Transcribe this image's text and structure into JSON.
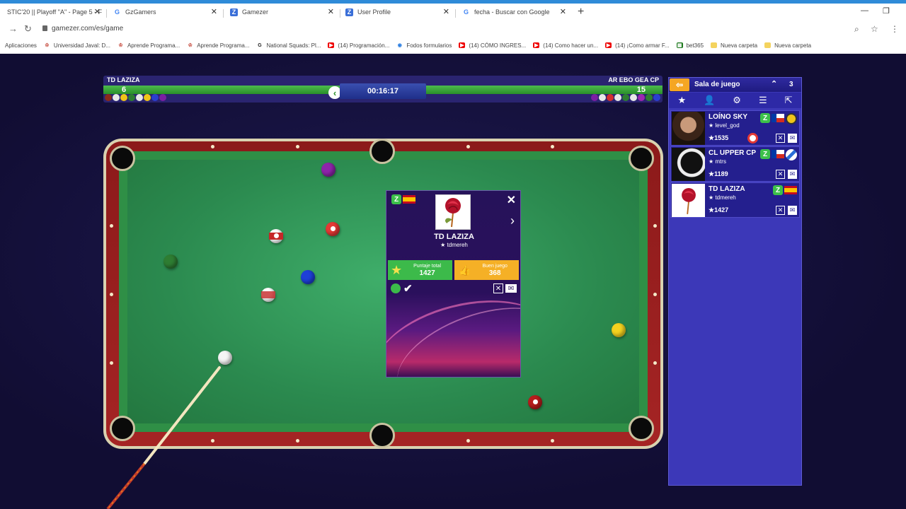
{
  "browser": {
    "tabs": [
      {
        "title": "STIC'20 || Playoff \"A\" - Page 5 - F",
        "favicon": "page-loading-icon"
      },
      {
        "title": "GzGamers",
        "favicon": "google-icon"
      },
      {
        "title": "Gamezer",
        "favicon": "gamezer-icon"
      },
      {
        "title": "User Profile",
        "favicon": "gamezer-icon"
      },
      {
        "title": "fecha - Buscar con Google",
        "favicon": "google-icon"
      }
    ],
    "url": "gamezer.com/es/game",
    "bookmarks": [
      {
        "label": "Aplicaciones",
        "icon": "apps-icon"
      },
      {
        "label": "Universidad Javal: D...",
        "icon": "university-icon"
      },
      {
        "label": "Aprende Programa...",
        "icon": "university-icon"
      },
      {
        "label": "Aprende Programa...",
        "icon": "university-icon"
      },
      {
        "label": "National Squads: Pl...",
        "icon": "google-icon"
      },
      {
        "label": "(14) Programación...",
        "icon": "youtube-icon"
      },
      {
        "label": "Fodos formularios",
        "icon": "forms-icon"
      },
      {
        "label": "(14) CÓMO INGRES...",
        "icon": "youtube-icon"
      },
      {
        "label": "(14) Como hacer un...",
        "icon": "youtube-icon"
      },
      {
        "label": "(14) ¡Como armar F...",
        "icon": "youtube-icon"
      },
      {
        "label": "bet365",
        "icon": "bet365-icon"
      },
      {
        "label": "Nueva carpeta",
        "icon": "folder-icon"
      },
      {
        "label": "Nueva carpeta",
        "icon": "folder-icon"
      }
    ]
  },
  "scorebar": {
    "left_player": "TD LAZIZA",
    "left_score": "6",
    "right_player": "AR EBO GEA CP",
    "right_score": "15",
    "timer": "00:16:17"
  },
  "popup": {
    "name": "TD LAZIZA",
    "username": "★ tdmereh",
    "total_label": "Puntaje total",
    "total_value": "1427",
    "good_label": "Buen juego",
    "good_value": "368"
  },
  "panel": {
    "title": "Sala de juego",
    "count": "3",
    "players": [
      {
        "name": "LOÍNO SKY",
        "user": "★ level_god",
        "score": "★1535",
        "flag": "cl"
      },
      {
        "name": "CL UPPER CP",
        "user": "★ mtrs",
        "score": "★1189",
        "flag": "cl"
      },
      {
        "name": "TD LAZIZA",
        "user": "★ tdmereh",
        "score": "★1427",
        "flag": "es"
      }
    ]
  },
  "colors": {
    "browser_accent": "#2f8bd8",
    "panel_bg": "#3c38b8",
    "felt": "#3fae6a",
    "wood": "#a52424",
    "total_box": "#3cba4a",
    "good_box": "#f5b026"
  }
}
